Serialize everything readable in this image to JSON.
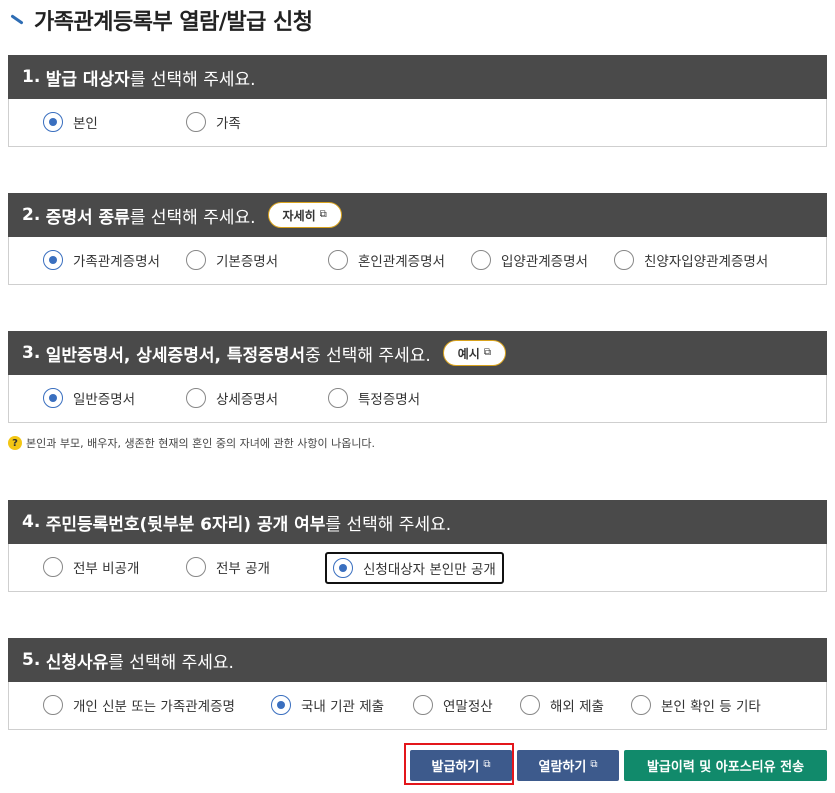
{
  "page_title": "가족관계등록부 열람/발급 신청",
  "sections": [
    {
      "num": "1.",
      "bold": "발급 대상자",
      "rest": "를 선택해 주세요.",
      "options": [
        "본인",
        "가족"
      ],
      "selected": 0
    },
    {
      "num": "2.",
      "bold": "증명서 종류",
      "rest": "를 선택해 주세요.",
      "pill": "자세히",
      "options": [
        "가족관계증명서",
        "기본증명서",
        "혼인관계증명서",
        "입양관계증명서",
        "친양자입양관계증명서"
      ],
      "selected": 0
    },
    {
      "num": "3.",
      "bold": "일반증명서, 상세증명서, 특정증명서",
      "rest": " 중 선택해 주세요.",
      "pill": "예시",
      "options": [
        "일반증명서",
        "상세증명서",
        "특정증명서"
      ],
      "selected": 0
    },
    {
      "num": "4.",
      "bold": "주민등록번호(뒷부분 6자리) 공개 여부",
      "rest": "를 선택해 주세요.",
      "options": [
        "전부 비공개",
        "전부 공개",
        "신청대상자 본인만 공개"
      ],
      "selected": 2
    },
    {
      "num": "5.",
      "bold": "신청사유",
      "rest": "를 선택해 주세요.",
      "options": [
        "개인 신분 또는 가족관계증명",
        "국내 기관 제출",
        "연말정산",
        "해외 제출",
        "본인 확인 등 기타"
      ],
      "selected": 1
    }
  ],
  "note": "본인과 부모, 배우자, 생존한 현재의 혼인 중의 자녀에 관한 사항이 나옵니다.",
  "buttons": {
    "issue": "발급하기",
    "view": "열람하기",
    "send": "발급이력 및 아포스티유 전송"
  }
}
